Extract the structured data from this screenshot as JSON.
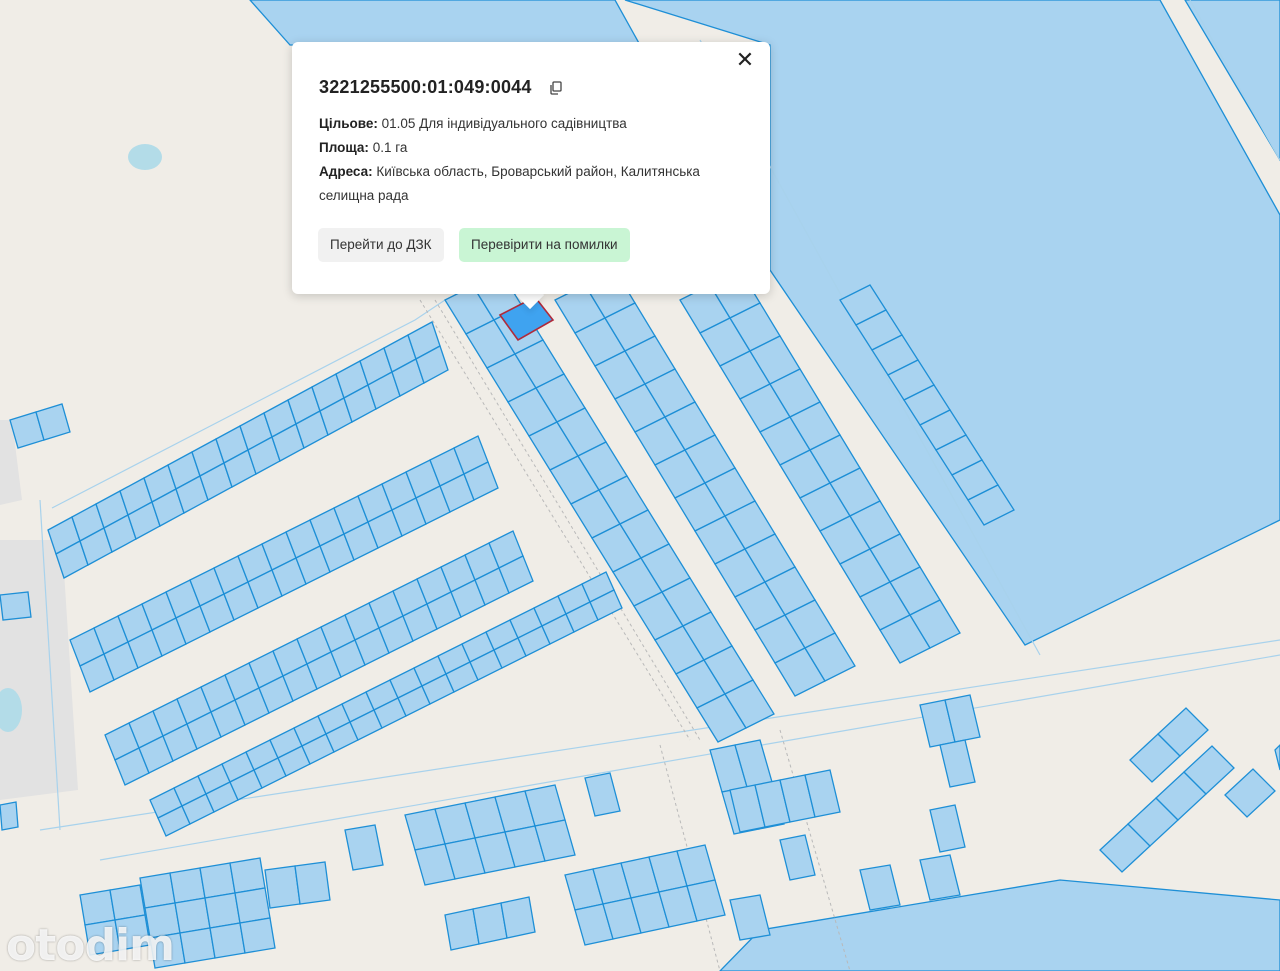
{
  "popup": {
    "cadastral_number": "3221255500:01:049:0044",
    "purpose_label": "Цільове:",
    "purpose_value": "01.05 Для індивідуального садівництва",
    "area_label": "Площа:",
    "area_value": "0.1 га",
    "address_label": "Адреса:",
    "address_value": "Київська область, Броварський район, Калитянська селищна рада",
    "close_symbol": "✕",
    "btn_dzk": "Перейти до ДЗК",
    "btn_check": "Перевірити на помилки"
  },
  "watermark": "otodim",
  "colors": {
    "parcel_fill": "#a9d3f0",
    "parcel_stroke": "#1e8fd6",
    "selected_parcel": "#3fa3f0",
    "check_button": "#c9f5d4",
    "background": "#f0ede7"
  },
  "icons": [
    "close-icon",
    "copy-icon"
  ]
}
